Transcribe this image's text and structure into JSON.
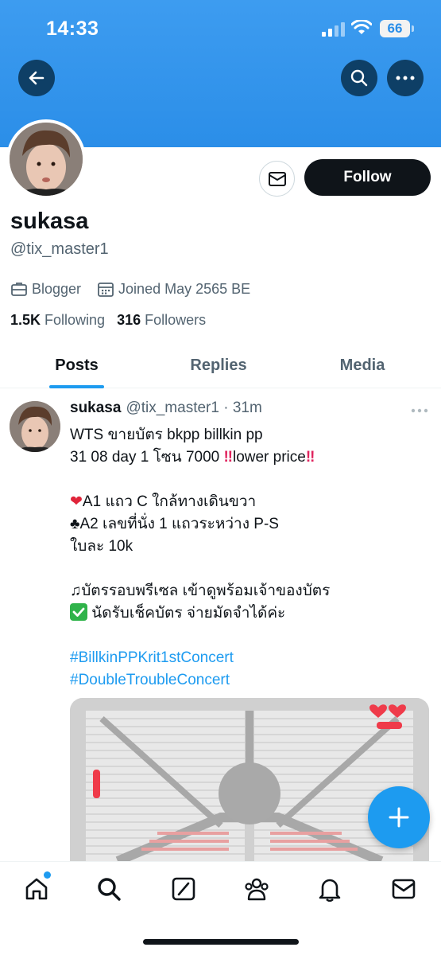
{
  "status_bar": {
    "time": "14:33",
    "battery": "66"
  },
  "header": {
    "back_icon": "arrow-left-icon",
    "search_icon": "search-icon",
    "more_icon": "more-horizontal-icon",
    "banner_color": "#2b8ee8"
  },
  "profile": {
    "display_name": "sukasa",
    "handle": "@tix_master1",
    "category": "Blogger",
    "joined": "Joined May 2565 BE",
    "following_count": "1.5K",
    "following_label": "Following",
    "followers_count": "316",
    "followers_label": "Followers",
    "message_icon": "mail-icon",
    "follow_label": "Follow"
  },
  "tabs": [
    {
      "label": "Posts",
      "active": true
    },
    {
      "label": "Replies",
      "active": false
    },
    {
      "label": "Media",
      "active": false
    }
  ],
  "tweet": {
    "name": "sukasa",
    "handle": "@tix_master1",
    "time": "31m",
    "lines": [
      "WTS ขายบัตร bkpp billkin pp",
      "31 08 day 1 โซน 7000 ",
      "lower price",
      "A1 แถว C ใกล้ทางเดินขวา",
      "A2 เลขที่นั่ง 1 แถวระหว่าง P-S",
      "ใบละ 10k",
      "บัตรรอบพรีเซล เข้าดูพร้อมเจ้าของบัตร",
      " นัดรับเช็คบัตร จ่ายมัดจำได้ค่ะ"
    ],
    "hashtags": [
      "#BillkinPPKrit1stConcert",
      "#DoubleTroubleConcert"
    ]
  },
  "colors": {
    "accent": "#1d9bf0",
    "text": "#0f1419",
    "muted": "#536471"
  },
  "bottom_nav": [
    {
      "icon": "home-icon"
    },
    {
      "icon": "search-icon"
    },
    {
      "icon": "grok-icon"
    },
    {
      "icon": "communities-icon"
    },
    {
      "icon": "notifications-icon"
    },
    {
      "icon": "messages-icon"
    }
  ],
  "fab": {
    "icon": "plus-icon"
  }
}
